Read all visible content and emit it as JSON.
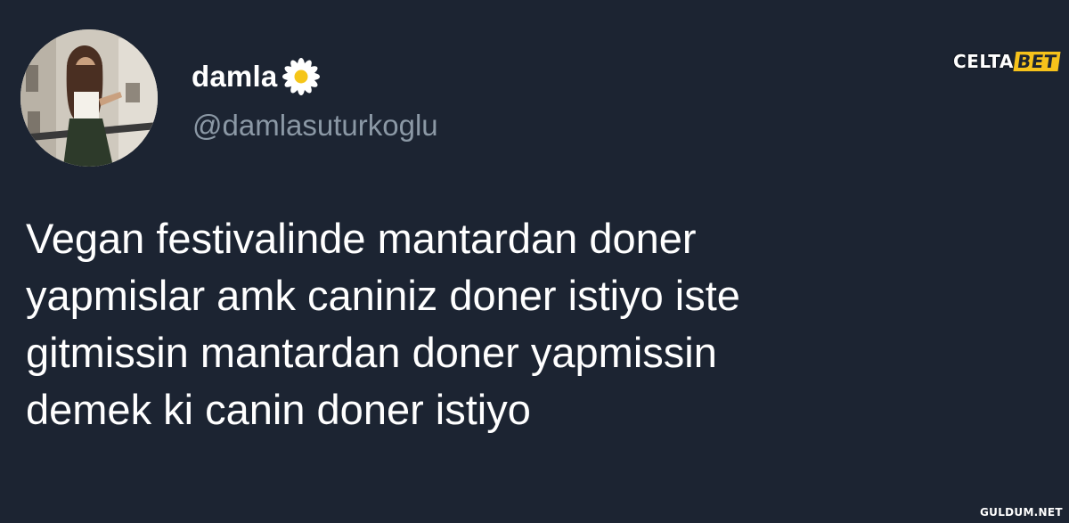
{
  "user": {
    "display_name": "damla",
    "name_emoji_icon": "daisy-flower-icon",
    "handle": "@damlasuturkoglu",
    "avatar_icon": "profile-photo"
  },
  "tweet": {
    "lines": [
      "Vegan festivalinde mantardan doner",
      "yapmislar amk caniniz doner istiyo iste",
      "gitmissin mantardan doner yapmissin",
      "demek ki canin doner istiyo"
    ]
  },
  "watermarks": {
    "top_part1": "CELTA",
    "top_part2": "BET",
    "bottom": "GULDUM.NET"
  },
  "colors": {
    "background": "#1c2432",
    "text_primary": "#ffffff",
    "text_secondary": "#8b98a5",
    "brand_yellow": "#f6c21b"
  }
}
